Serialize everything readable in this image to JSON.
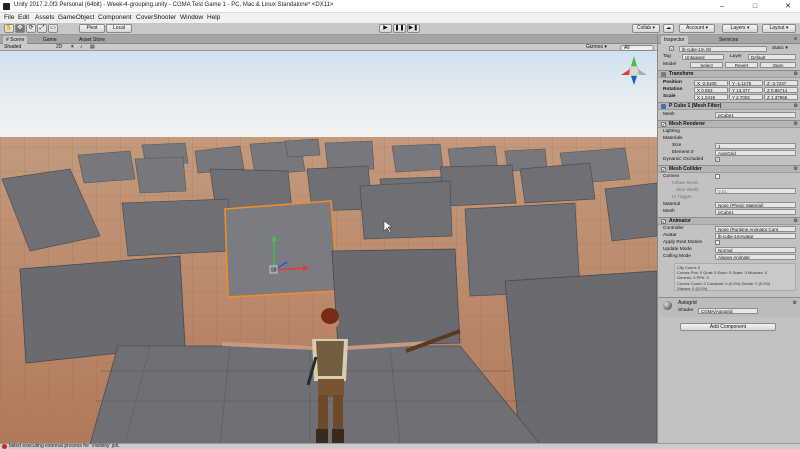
{
  "window": {
    "title": "Unity 2017.2.0f3 Personal (64bit) - Week-4-grouping.unity - CGMA Test Game 1 - PC, Mac & Linux Standalone* <DX11>",
    "minimize": "–",
    "maximize": "□",
    "close": "✕"
  },
  "menu": [
    "File",
    "Edit",
    "Assets",
    "GameObject",
    "Component",
    "CoverShooter",
    "Window",
    "Help"
  ],
  "toolbar": {
    "pivot": "Pivot",
    "local": "Local",
    "collab": "Collab ▾",
    "cloud": "☁",
    "account": "Account ▾",
    "layers": "Layers ▾",
    "layout": "Layout ▾"
  },
  "tabs": {
    "scene": "# Scene",
    "game": "Game",
    "asset_store": "Asset Store",
    "inspector": "Inspector",
    "services": "Services"
  },
  "scene_bar": {
    "shaded": "Shaded",
    "mode_2d": "2D",
    "gizmos": "Gizmos ▾",
    "search_all": "All"
  },
  "status": {
    "message": "failed executing external process for 'Visibility' job."
  },
  "inspector": {
    "object_name": "lb-cube-1m (9)",
    "static_label": "Static ▾",
    "tag_label": "Tag",
    "tag_value": "Untagged",
    "layer_label": "Layer",
    "layer_value": "Default",
    "model_label": "Model",
    "model_select": "Select",
    "model_revert": "Revert",
    "model_open": "Open",
    "transform": {
      "title": "Transform",
      "position_label": "Position",
      "rotation_label": "Rotation",
      "scale_label": "Scale",
      "position": {
        "x": "X -2.5100",
        "y": "Y -1.1175",
        "z": "Z -3.7237"
      },
      "rotation": {
        "x": "X 0.553",
        "y": "Y 13.377",
        "z": "Z 0.86714"
      },
      "scale": {
        "x": "X 1.0419",
        "y": "Y 2.7002",
        "z": "Z 1.37965"
      }
    },
    "mesh_filter": {
      "title": "P Cube 1 (Mesh Filter)",
      "mesh_label": "Mesh",
      "mesh_value": "pCube1"
    },
    "mesh_renderer": {
      "title": "Mesh Renderer",
      "lighting": "Lighting",
      "materials": "Materials",
      "size_label": "Size",
      "size_value": "1",
      "element_label": "Element 0",
      "element_value": "AutoGrid",
      "dynamic_label": "Dynamic Occluded"
    },
    "mesh_collider": {
      "title": "Mesh Collider",
      "convex": "Convex",
      "inflate": "Inflate Mesh",
      "skin_label": "Skin Width",
      "skin_value": "0.01",
      "is_trigger": "Is Trigger",
      "material_label": "Material",
      "material_value": "None (Physic Material)",
      "mesh_label": "Mesh",
      "mesh_value": "pCube1"
    },
    "animator": {
      "title": "Animator",
      "controller_label": "Controller",
      "controller_value": "None (Runtime Animator Cont",
      "avatar_label": "Avatar",
      "avatar_value": "lb-cube-1mAvatar",
      "root_motion_label": "Apply Root Motion",
      "update_label": "Update Mode",
      "update_value": "Normal",
      "culling_label": "Culling Mode",
      "culling_value": "Always Animate",
      "info": [
        "Clip Count: 0",
        "Curves Pos: 0 Quat: 0 Euler: 0 Scale: 0 Muscles: 0",
        "Generic: 0 PPtr: 0",
        "Curves Count: 0 Constant: 0 (0.0%) Dense: 0 (0.0%)",
        "Stream: 0 (0.0%)"
      ]
    },
    "material": {
      "name": "Autogrid",
      "shader_label": "Shader",
      "shader_value": "CGMA/Autogrid"
    },
    "add_component": "Add Component"
  }
}
